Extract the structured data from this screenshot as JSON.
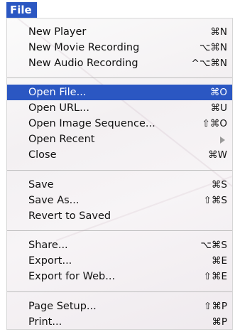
{
  "menu_title": "File",
  "items": [
    {
      "label": "New Player",
      "shortcut": "⌘N"
    },
    {
      "label": "New Movie Recording",
      "shortcut": "⌥⌘N"
    },
    {
      "label": "New Audio Recording",
      "shortcut": "^⌥⌘N"
    },
    {
      "label": "Open File...",
      "shortcut": "⌘O"
    },
    {
      "label": "Open URL...",
      "shortcut": "⌘U"
    },
    {
      "label": "Open Image Sequence...",
      "shortcut": "⇧⌘O"
    },
    {
      "label": "Open Recent",
      "shortcut": ""
    },
    {
      "label": "Close",
      "shortcut": "⌘W"
    },
    {
      "label": "Save",
      "shortcut": "⌘S"
    },
    {
      "label": "Save As...",
      "shortcut": "⇧⌘S"
    },
    {
      "label": "Revert to Saved",
      "shortcut": ""
    },
    {
      "label": "Share...",
      "shortcut": "⌥⌘S"
    },
    {
      "label": "Export...",
      "shortcut": "⌘E"
    },
    {
      "label": "Export for Web...",
      "shortcut": "⇧⌘E"
    },
    {
      "label": "Page Setup...",
      "shortcut": "⇧⌘P"
    },
    {
      "label": "Print...",
      "shortcut": "⌘P"
    }
  ],
  "highlighted_item": "Open File...",
  "submenu_icon": "triangle-right-icon",
  "colors": {
    "highlight": "#2b57c2",
    "highlight_text": "#ffffff",
    "text": "#111111",
    "separator": "#bdbdbd"
  }
}
